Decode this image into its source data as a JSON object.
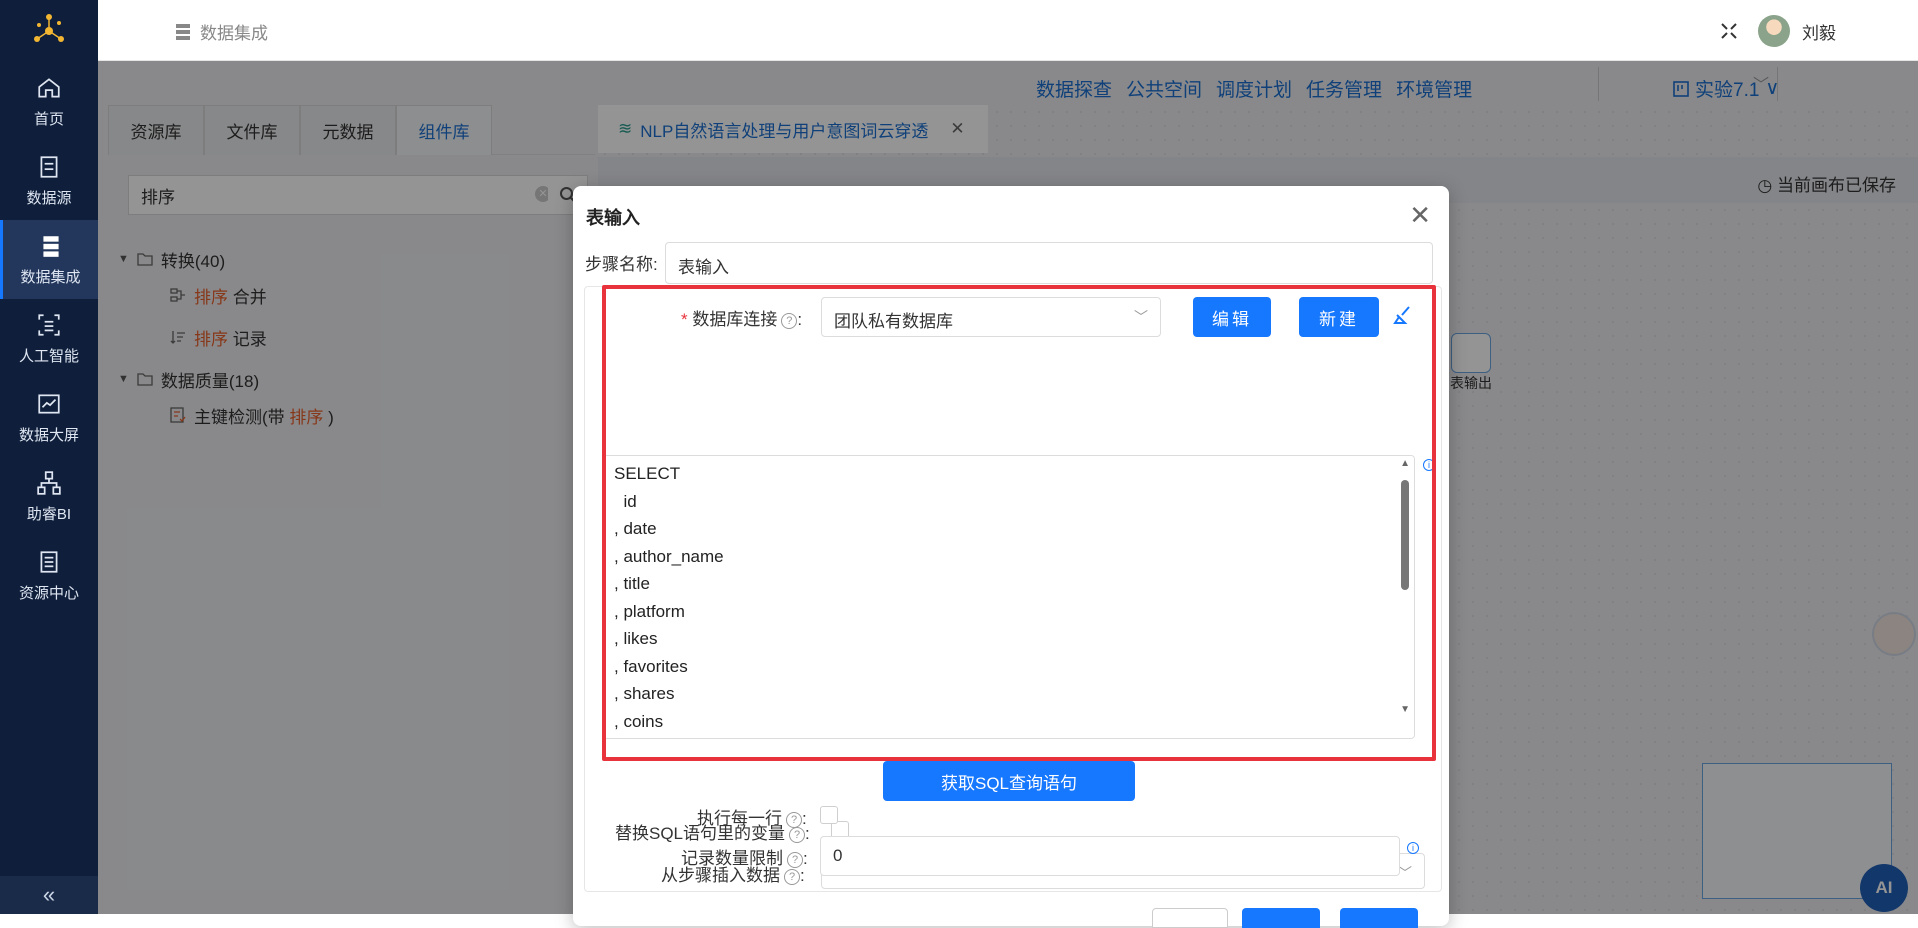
{
  "sidebar": {
    "items": [
      {
        "label": "首页",
        "icon": "home-icon"
      },
      {
        "label": "数据源",
        "icon": "database-icon"
      },
      {
        "label": "数据集成",
        "icon": "server-icon"
      },
      {
        "label": "人工智能",
        "icon": "ai-scan-icon"
      },
      {
        "label": "数据大屏",
        "icon": "chart-icon"
      },
      {
        "label": "助睿BI",
        "icon": "org-chart-icon"
      },
      {
        "label": "资源中心",
        "icon": "document-icon"
      }
    ],
    "active_index": 2,
    "collapse": "«"
  },
  "header": {
    "breadcrumb": "数据集成",
    "user": "刘毅"
  },
  "top_menu": [
    "数据探查",
    "公共空间",
    "调度计划",
    "任务管理",
    "环境管理"
  ],
  "project": "实验7.1",
  "left_tabs": [
    "资源库",
    "文件库",
    "元数据",
    "组件库"
  ],
  "active_left_tab": 3,
  "search": {
    "value": "排序"
  },
  "tree": {
    "group1": "转换(40)",
    "g1_item1_hl": "排序",
    "g1_item1_rest": " 合并",
    "g1_item2_hl": "排序",
    "g1_item2_rest": " 记录",
    "group2": "数据质量(18)",
    "g2_item1_pre": "主键检测(带 ",
    "g2_item1_hl": "排序",
    "g2_item1_post": " )"
  },
  "canvas": {
    "tab_title": "NLP自然语言处理与用户意图词云穿透",
    "saved_status": "当前画布已保存",
    "node_label": "表输出"
  },
  "dialog": {
    "title": "表输入",
    "step_name_label": "步骤名称:",
    "step_name_value": "表输入",
    "db_conn_label": "数据库连接",
    "db_conn_value": "团队私有数据库",
    "edit_btn": "编辑",
    "new_btn": "新建",
    "sql_lines": [
      "SELECT",
      "  id",
      ", date",
      ", author_name",
      ", title",
      ", platform",
      ", likes",
      ", favorites",
      ", shares",
      ", coins"
    ],
    "get_sql_btn": "获取SQL查询语句",
    "replace_var_label": "替换SQL语句里的变量",
    "insert_from_step_label": "从步骤插入数据",
    "exec_each_row_label": "执行每一行",
    "limit_label": "记录数量限制",
    "limit_value": "0"
  },
  "ai_label": "AI",
  "colors": {
    "sidebar": "#0f1f3b",
    "primary": "#1677ff",
    "highlight": "#e8612c",
    "annotation": "#e8323c"
  }
}
